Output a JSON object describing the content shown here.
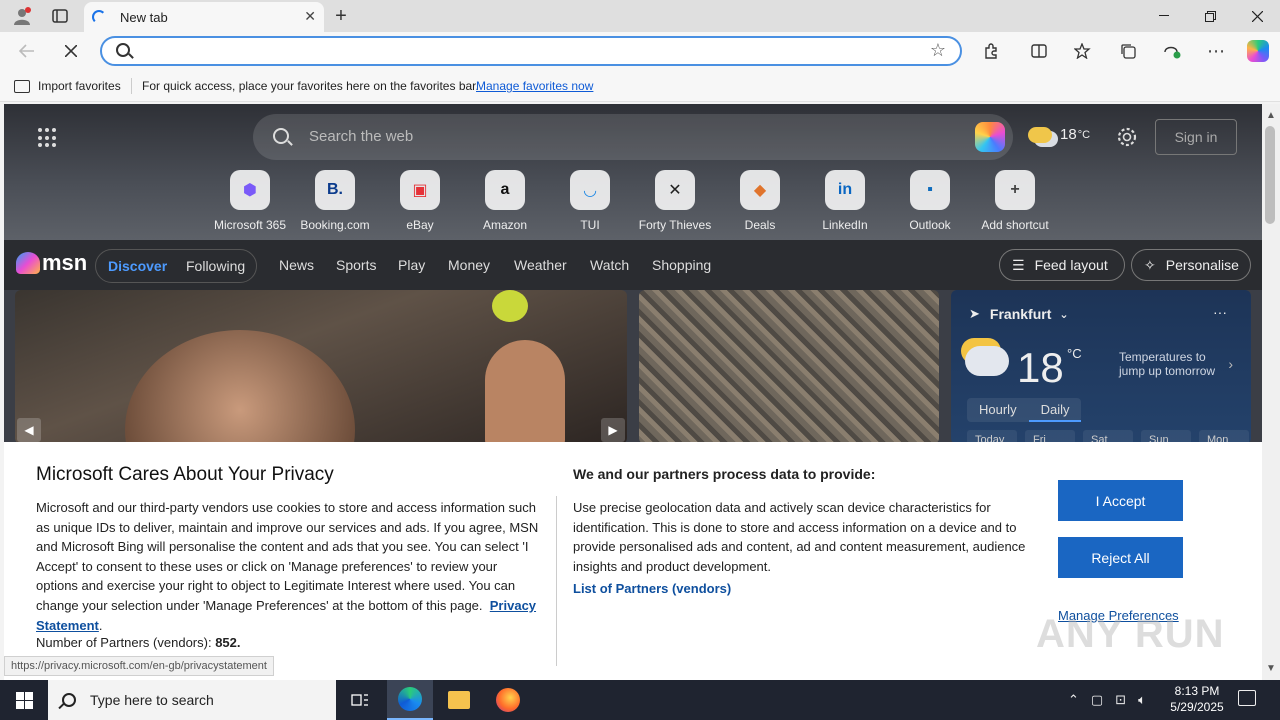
{
  "browser": {
    "tab_title": "New tab",
    "new_tab_symbol": "+",
    "tab_close_symbol": "✕",
    "address_value": "",
    "address_placeholder": "",
    "star_symbol": "☆"
  },
  "favorites_bar": {
    "import_label": "Import favorites",
    "hint": "For quick access, place your favorites here on the favorites bar.",
    "manage_link": "Manage favorites now"
  },
  "ntp": {
    "search_placeholder": "Search the web",
    "weather_temp": "18",
    "weather_unit": "°C",
    "sign_in": "Sign in",
    "shortcuts": [
      {
        "label": "Microsoft 365",
        "glyph": "⬢",
        "color": "#7a5af8"
      },
      {
        "label": "Booking.com",
        "glyph": "B.",
        "color": "#0b3b8c"
      },
      {
        "label": "eBay",
        "glyph": "▣",
        "color": "#e53238"
      },
      {
        "label": "Amazon",
        "glyph": "a",
        "color": "#111111"
      },
      {
        "label": "TUI",
        "glyph": "◡",
        "color": "#1e88e5"
      },
      {
        "label": "Forty Thieves",
        "glyph": "✕",
        "color": "#222222"
      },
      {
        "label": "Deals",
        "glyph": "◆",
        "color": "#e0742c"
      },
      {
        "label": "LinkedIn",
        "glyph": "in",
        "color": "#0a66c2"
      },
      {
        "label": "Outlook",
        "glyph": "▪",
        "color": "#0f6cbd"
      },
      {
        "label": "Add shortcut",
        "glyph": "+",
        "color": "#444444"
      }
    ]
  },
  "msn": {
    "logo": "msn",
    "discover": "Discover",
    "following": "Following",
    "categories": [
      "News",
      "Sports",
      "Play",
      "Money",
      "Weather",
      "Watch",
      "Shopping"
    ],
    "feed_layout": "Feed layout",
    "personalise": "Personalise"
  },
  "weather_card": {
    "city": "Frankfurt",
    "more": "···",
    "temp": "18",
    "unit": "°C",
    "note": "Temperatures to jump up tomorrow",
    "tab_hourly": "Hourly",
    "tab_daily": "Daily",
    "days": [
      "Today",
      "Fri",
      "Sat",
      "Sun",
      "Mon"
    ]
  },
  "privacy": {
    "title": "Microsoft Cares About Your Privacy",
    "body": "Microsoft and our third-party vendors use cookies to store and access information such as unique IDs to deliver, maintain and improve our services and ads. If you agree, MSN and Microsoft Bing will personalise the content and ads that you see. You can select 'I Accept' to consent to these uses or click on 'Manage preferences' to review your options and exercise your right to object to Legitimate Interest where used.  You can change your selection under 'Manage Preferences' at the bottom of this page.",
    "privacy_link": "Privacy Statement",
    "partners_label": "Number of Partners (vendors):",
    "partners_count": "852.",
    "right_title": "We and our partners process data to provide:",
    "right_body": "Use precise geolocation data and actively scan device characteristics for identification. This is done to store and access information on a device and to provide personalised ads and content, ad and content measurement, audience insights and product development.",
    "vendors_link": "List of Partners (vendors)",
    "accept": "I Accept",
    "reject": "Reject All",
    "manage": "Manage Preferences"
  },
  "status_url": "https://privacy.microsoft.com/en-gb/privacystatement",
  "watermark": "ANY RUN",
  "taskbar": {
    "search_placeholder": "Type here to search",
    "time": "8:13 PM",
    "date": "5/29/2025"
  }
}
